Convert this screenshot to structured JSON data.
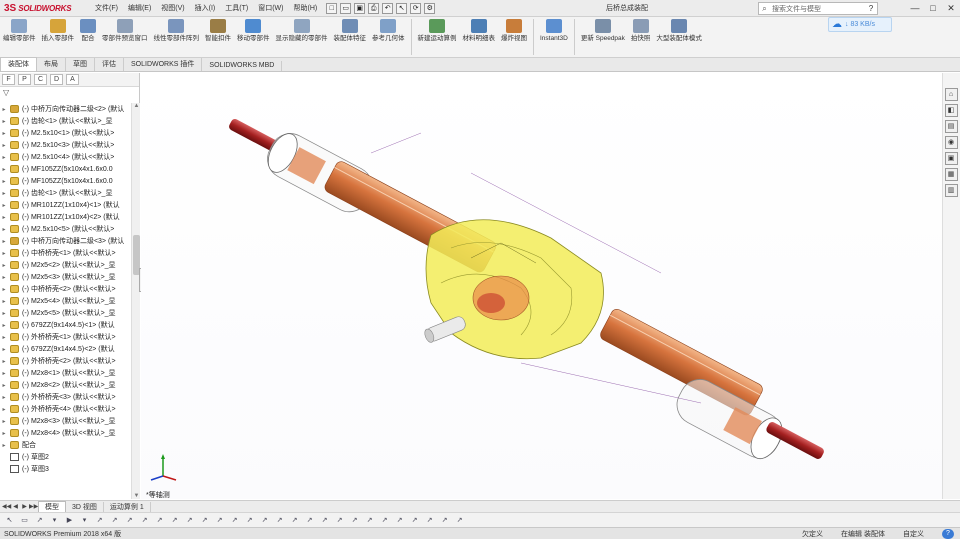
{
  "app": {
    "logo_ds": "3S",
    "logo_text": "SOLIDWORKS",
    "doc_title": "后桥总成装配",
    "window_buttons": [
      "—",
      "□",
      "✕"
    ]
  },
  "menu": [
    "文件(F)",
    "编辑(E)",
    "视图(V)",
    "插入(I)",
    "工具(T)",
    "窗口(W)",
    "帮助(H)"
  ],
  "search": {
    "placeholder": "搜索文件与模型",
    "icon": "search-icon",
    "go": "?"
  },
  "net_badge": {
    "speed": "↓ 83 KB/s"
  },
  "ribbon": [
    {
      "label": "编辑零部件",
      "color": "#8aa5c8"
    },
    {
      "label": "插入零部件",
      "color": "#d6a43a"
    },
    {
      "label": "配合",
      "color": "#6b8fc0"
    },
    {
      "label": "零部件预览窗口",
      "color": "#8ea0b8"
    },
    {
      "label": "线性零部件阵列",
      "color": "#7a95bd"
    },
    {
      "label": "智能扣件",
      "color": "#9a7d46"
    },
    {
      "label": "移动零部件",
      "color": "#4f8bd0"
    },
    {
      "label": "显示隐藏的零部件",
      "color": "#8fa5c0"
    },
    {
      "label": "装配体特征",
      "color": "#6f8db5"
    },
    {
      "label": "参考几何体",
      "color": "#7fa0c8"
    },
    {
      "label": "新建运动算例",
      "color": "#5a9a5a"
    },
    {
      "label": "材料明细表",
      "color": "#4d7fb5"
    },
    {
      "label": "爆炸视图",
      "color": "#c87d3a"
    },
    {
      "label": "Instant3D",
      "color": "#5c8fd0"
    },
    {
      "label": "更新 Speedpak",
      "color": "#7a8fa8"
    },
    {
      "label": "拍快照",
      "color": "#8a9cb5"
    },
    {
      "label": "大型装配体模式",
      "color": "#6a87b0"
    }
  ],
  "tabs": [
    "装配体",
    "布局",
    "草图",
    "评估",
    "SOLIDWORKS 插件",
    "SOLIDWORKS MBD"
  ],
  "left_panel": {
    "icons": [
      "F",
      "P",
      "C",
      "D",
      "A"
    ],
    "filter": "▽",
    "tree": [
      {
        "text": "(-) 中桥万向传动器二级<2> (默认",
        "kind": "sub"
      },
      {
        "text": "(-) 齿轮<1> (默认<<默认>_显",
        "kind": "part"
      },
      {
        "text": "(-) M2.5x10<1> (默认<<默认>",
        "kind": "part"
      },
      {
        "text": "(-) M2.5x10<3> (默认<<默认>",
        "kind": "part"
      },
      {
        "text": "(-) M2.5x10<4> (默认<<默认>",
        "kind": "part"
      },
      {
        "text": "(-) MF105ZZ(5x10x4x1.6x0.0",
        "kind": "part"
      },
      {
        "text": "(-) MF105ZZ(5x10x4x1.6x0.0",
        "kind": "part"
      },
      {
        "text": "(-) 齿轮<1> (默认<<默认>_显",
        "kind": "part"
      },
      {
        "text": "(-) MR101ZZ(1x10x4)<1> (默认",
        "kind": "part"
      },
      {
        "text": "(-) MR101ZZ(1x10x4)<2> (默认",
        "kind": "part"
      },
      {
        "text": "(-) M2.5x10<5> (默认<<默认>",
        "kind": "part"
      },
      {
        "text": "(-) 中桥万向传动器二级<3> (默认",
        "kind": "sub"
      },
      {
        "text": "(-) 中桥桥壳<1> (默认<<默认>",
        "kind": "part"
      },
      {
        "text": "(-) M2x5<2> (默认<<默认>_显",
        "kind": "part"
      },
      {
        "text": "(-) M2x5<3> (默认<<默认>_显",
        "kind": "part"
      },
      {
        "text": "(-) 中桥桥壳<2> (默认<<默认>",
        "kind": "part"
      },
      {
        "text": "(-) M2x5<4> (默认<<默认>_显",
        "kind": "part"
      },
      {
        "text": "(-) M2x5<5> (默认<<默认>_显",
        "kind": "part"
      },
      {
        "text": "(-) 679ZZ(9x14x4.5)<1> (默认",
        "kind": "part"
      },
      {
        "text": "(-) 外桥桥壳<1> (默认<<默认>",
        "kind": "part"
      },
      {
        "text": "(-) 679ZZ(9x14x4.5)<2> (默认",
        "kind": "part"
      },
      {
        "text": "(-) 外桥桥壳<2> (默认<<默认>",
        "kind": "part"
      },
      {
        "text": "(-) M2x8<1> (默认<<默认>_显",
        "kind": "part"
      },
      {
        "text": "(-) M2x8<2> (默认<<默认>_显",
        "kind": "part"
      },
      {
        "text": "(-) 外桥桥壳<3> (默认<<默认>",
        "kind": "part"
      },
      {
        "text": "(-) 外桥桥壳<4> (默认<<默认>",
        "kind": "part"
      },
      {
        "text": "(-) M2x8<3> (默认<<默认>_显",
        "kind": "part"
      },
      {
        "text": "(-) M2x8<4> (默认<<默认>_显",
        "kind": "part"
      },
      {
        "text": "配合",
        "kind": "folder"
      },
      {
        "text": "(-) 草图2",
        "kind": "cfg"
      },
      {
        "text": "(-) 草图3",
        "kind": "cfg"
      }
    ]
  },
  "viewport": {
    "view_label": "*等轴测",
    "heads_up": [
      "🔍",
      "🔍",
      "✎",
      "▣",
      "◧",
      "▾",
      "◐",
      "▾",
      "⚙",
      "▾",
      "◉",
      "▾",
      "▭",
      "▾"
    ],
    "window_controls": [
      "▭",
      "⧉",
      "✕"
    ]
  },
  "right_side": [
    "⌂",
    "◧",
    "▤",
    "◉",
    "▣",
    "▦",
    "▥"
  ],
  "bottom_tabs": {
    "navs": [
      "◀◀",
      "◀",
      "▶",
      "▶▶"
    ],
    "tabs": [
      "模型",
      "3D 视图",
      "运动算例 1"
    ]
  },
  "bottom_toolbar": [
    "↖",
    "▭",
    "↗",
    "▾",
    "▶",
    "▾",
    "↗",
    "↗",
    "↗",
    "↗",
    "↗",
    "↗",
    "↗",
    "↗",
    "↗",
    "↗",
    "↗",
    "↗",
    "↗",
    "↗",
    "↗",
    "↗",
    "↗",
    "↗",
    "↗",
    "↗",
    "↗",
    "↗",
    "↗",
    "↗",
    "↗"
  ],
  "status": {
    "left": "SOLIDWORKS Premium 2018 x64 版",
    "items": [
      "欠定义",
      "在编辑 装配体",
      "自定义"
    ],
    "help": "?"
  }
}
